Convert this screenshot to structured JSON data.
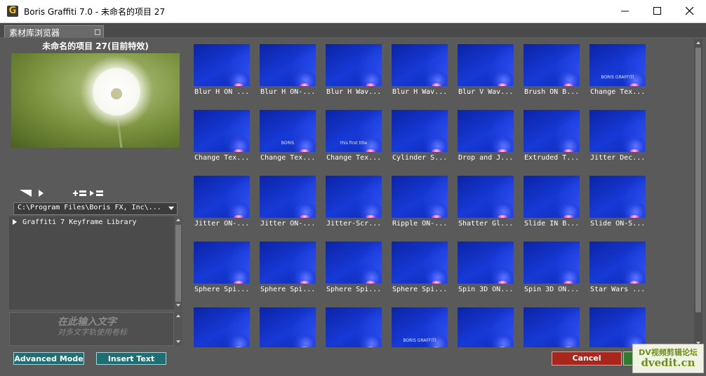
{
  "window": {
    "title": "Boris Graffiti 7.0 - 未命名的项目 27",
    "app_icon_letter": "G",
    "minimize": "minimize-icon",
    "maximize": "maximize-icon",
    "close": "close-icon"
  },
  "tab": {
    "label": "素材库浏览器"
  },
  "preview": {
    "title": "未命名的项目 27(目前特效)"
  },
  "path": {
    "value": "C:\\Program Files\\Boris FX, Inc\\..."
  },
  "tree": {
    "items": [
      {
        "label": "Graffiti 7 Keyframe Library"
      }
    ]
  },
  "text_entry": {
    "line1": "在此输入文字",
    "line2": "对多文字轨使用卷标"
  },
  "buttons": {
    "advanced_mode": "Advanced Mode",
    "insert_text": "Insert Text",
    "cancel": "Cancel",
    "ok": ""
  },
  "grid": {
    "items": [
      {
        "label": "Blur H ON ...",
        "overlay": ""
      },
      {
        "label": "Blur H ON-...",
        "overlay": ""
      },
      {
        "label": "Blur H Wav...",
        "overlay": ""
      },
      {
        "label": "Blur H Wav...",
        "overlay": ""
      },
      {
        "label": "Blur V Wav...",
        "overlay": ""
      },
      {
        "label": "Brush ON B...",
        "overlay": ""
      },
      {
        "label": "Change Tex...",
        "overlay": "BORIS GRAFFITI"
      },
      {
        "label": "Change Tex...",
        "overlay": ""
      },
      {
        "label": "Change Tex...",
        "overlay": "BORIS"
      },
      {
        "label": "Change Tex...",
        "overlay": "this first title"
      },
      {
        "label": "Cylinder S...",
        "overlay": ""
      },
      {
        "label": "Drop and J...",
        "overlay": ""
      },
      {
        "label": "Extruded T...",
        "overlay": ""
      },
      {
        "label": "Jitter Dec...",
        "overlay": ""
      },
      {
        "label": "Jitter ON-...",
        "overlay": ""
      },
      {
        "label": "Jitter ON-...",
        "overlay": ""
      },
      {
        "label": "Jitter-Scr...",
        "overlay": ""
      },
      {
        "label": "Ripple ON-...",
        "overlay": ""
      },
      {
        "label": "Shatter Gl...",
        "overlay": ""
      },
      {
        "label": "Slide IN B...",
        "overlay": ""
      },
      {
        "label": "Slide ON-S...",
        "overlay": ""
      },
      {
        "label": "Sphere Spi...",
        "overlay": ""
      },
      {
        "label": "Sphere Spi...",
        "overlay": ""
      },
      {
        "label": "Sphere Spi...",
        "overlay": ""
      },
      {
        "label": "Sphere Spi...",
        "overlay": ""
      },
      {
        "label": "Spin 3D ON...",
        "overlay": ""
      },
      {
        "label": "Spin 3D ON...",
        "overlay": ""
      },
      {
        "label": "Star Wars ...",
        "overlay": ""
      },
      {
        "label": "",
        "overlay": ""
      },
      {
        "label": "",
        "overlay": ""
      },
      {
        "label": "",
        "overlay": ""
      },
      {
        "label": "",
        "overlay": "BORIS GRAFFITI"
      },
      {
        "label": "",
        "overlay": ""
      },
      {
        "label": "",
        "overlay": ""
      },
      {
        "label": "",
        "overlay": ""
      }
    ]
  },
  "watermark": {
    "line1": "DV视频剪辑论坛",
    "line2": "dvedit.cn"
  },
  "colors": {
    "teal_button": "#1e6f73",
    "cancel_button": "#a9261c",
    "thumb_blue": "#1739d6",
    "panel_bg": "#5a5a5a"
  }
}
